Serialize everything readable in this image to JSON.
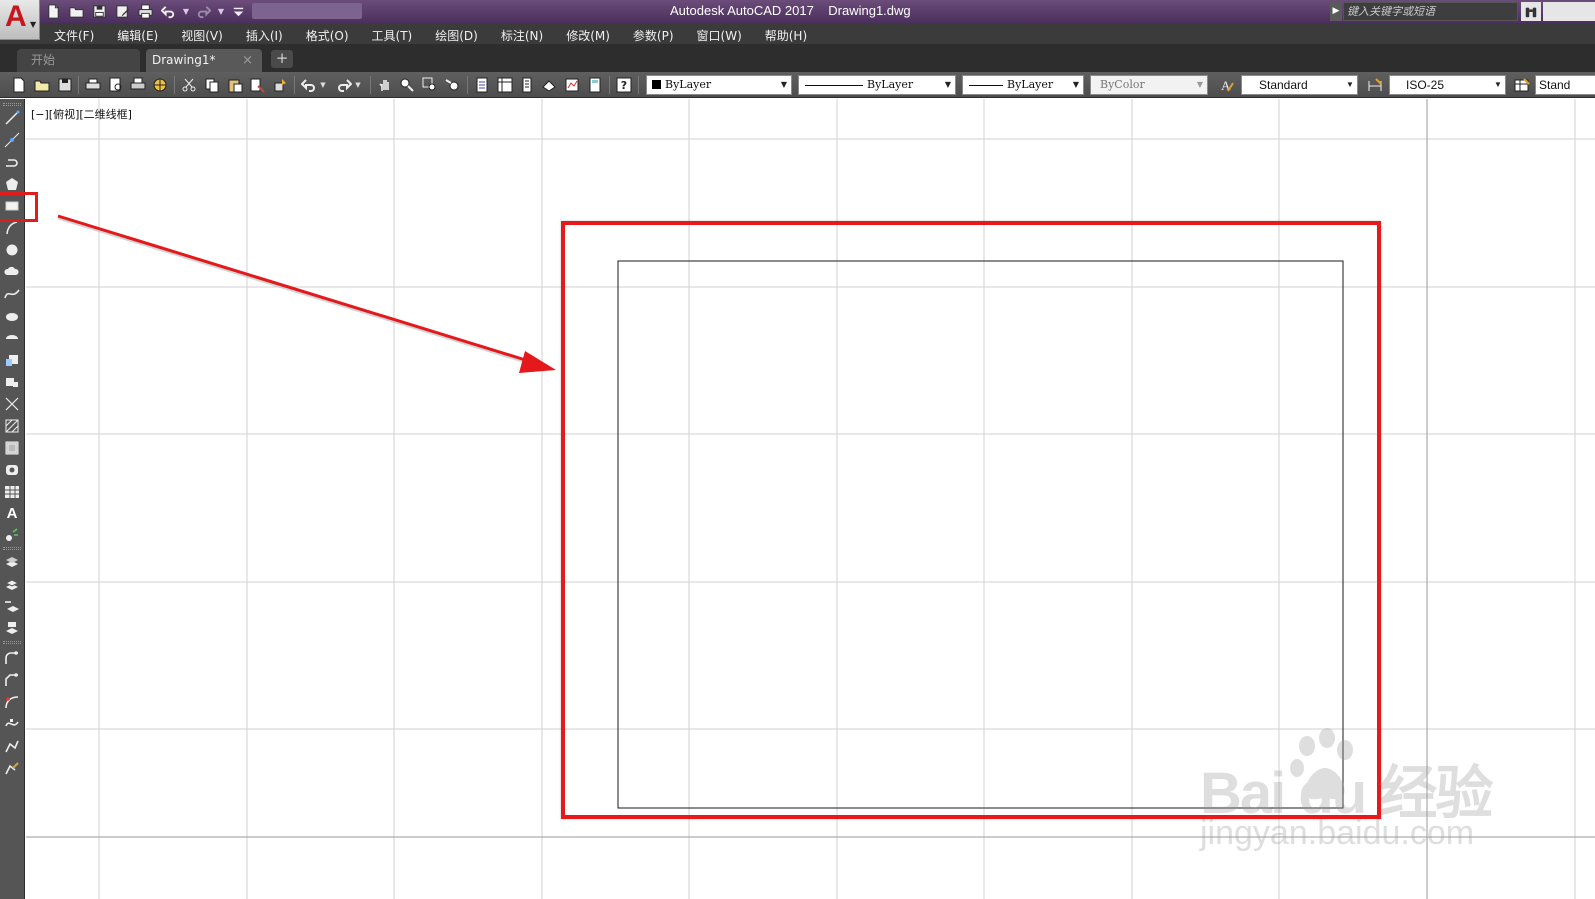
{
  "app": {
    "logo_letter": "A",
    "window_title": "Autodesk AutoCAD 2017    Drawing1.dwg",
    "search_placeholder": "键入关键字或短语"
  },
  "quick_access": {
    "icons": [
      "new-file-icon",
      "open-folder-icon",
      "save-icon",
      "save-as-icon",
      "print-icon",
      "undo-icon",
      "redo-icon",
      "customize-dropdown-icon"
    ]
  },
  "menu": {
    "items": [
      {
        "label": "文件(F)"
      },
      {
        "label": "编辑(E)"
      },
      {
        "label": "视图(V)"
      },
      {
        "label": "插入(I)"
      },
      {
        "label": "格式(O)"
      },
      {
        "label": "工具(T)"
      },
      {
        "label": "绘图(D)"
      },
      {
        "label": "标注(N)"
      },
      {
        "label": "修改(M)"
      },
      {
        "label": "参数(P)"
      },
      {
        "label": "窗口(W)"
      },
      {
        "label": "帮助(H)"
      }
    ]
  },
  "tabs": {
    "start_label": "开始",
    "drawing_label": "Drawing1*",
    "close_glyph": "×",
    "add_glyph": "+"
  },
  "toolbar": {
    "color_value": "ByLayer",
    "linetype_value": "ByLayer",
    "lineweight_value": "ByLayer",
    "plotstyle_value": "ByColor",
    "text_style_value": "Standard",
    "dim_style_value": "ISO-25",
    "table_style_value": "Stand"
  },
  "left_toolbar": {
    "text_tool_glyph": "A"
  },
  "canvas": {
    "viewport_label": "[−][俯视][二维线框]"
  },
  "watermark": {
    "brand": "Bai du 经验",
    "url": "jingyan.baidu.com"
  },
  "colors": {
    "titlebar": "#5a3d6b",
    "menubar": "#3b3b3b",
    "highlight_red": "#e8191b",
    "grid_line": "#cfcfcf",
    "canvas": "#ffffff"
  }
}
